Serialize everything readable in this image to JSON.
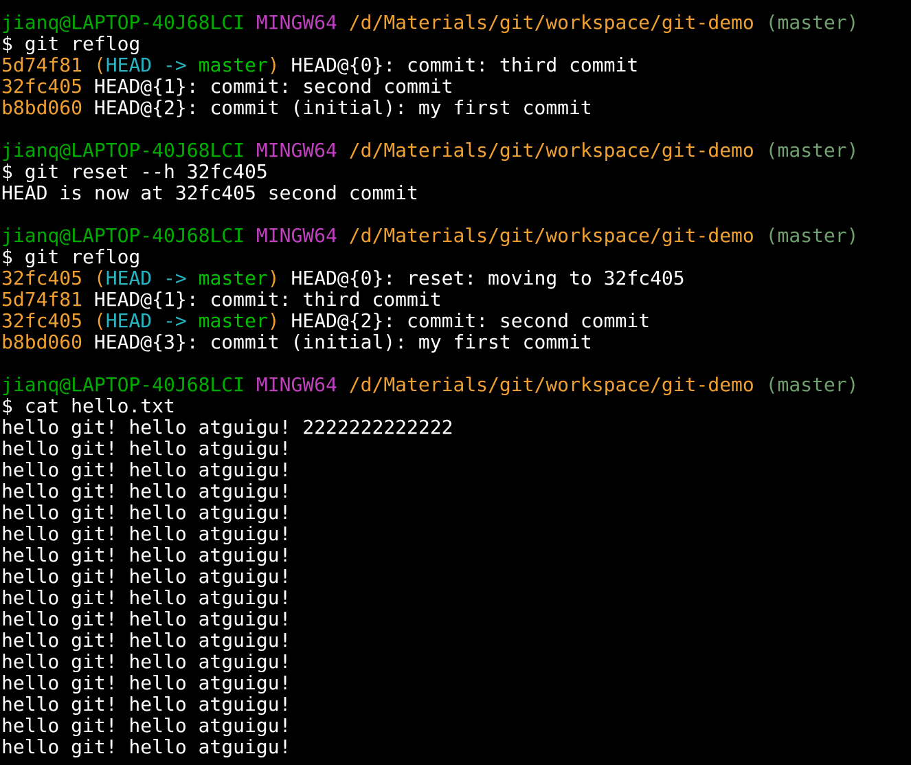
{
  "colors": {
    "background": "#000000",
    "text": "#ffffff",
    "user_host": "#00ab00",
    "mingw": "#bf3fbf",
    "path": "#f0a030",
    "branch": "#70a070",
    "hash": "#f0a030",
    "head_ref": "#27b5c2",
    "master_ref": "#00c000"
  },
  "prompt": {
    "user_host": "jianq@LAPTOP-40J68LCI",
    "system": "MINGW64",
    "path": "/d/Materials/git/workspace/git-demo",
    "branch": "(master)",
    "symbol": "$"
  },
  "blocks": [
    {
      "command": "git reflog",
      "output": [
        {
          "hash": "5d74f81",
          "decor": true,
          "text": "HEAD@{0}: commit: third commit"
        },
        {
          "hash": "32fc405",
          "decor": false,
          "text": "HEAD@{1}: commit: second commit"
        },
        {
          "hash": "b8bd060",
          "decor": false,
          "text": "HEAD@{2}: commit (initial): my first commit"
        }
      ]
    },
    {
      "command": "git reset --h 32fc405",
      "plain_output": [
        "HEAD is now at 32fc405 second commit"
      ]
    },
    {
      "command": "git reflog",
      "output": [
        {
          "hash": "32fc405",
          "decor": true,
          "text": "HEAD@{0}: reset: moving to 32fc405"
        },
        {
          "hash": "5d74f81",
          "decor": false,
          "text": "HEAD@{1}: commit: third commit"
        },
        {
          "hash": "32fc405",
          "decor": true,
          "text": "HEAD@{2}: commit: second commit"
        },
        {
          "hash": "b8bd060",
          "decor": false,
          "text": "HEAD@{3}: commit (initial): my first commit"
        }
      ]
    },
    {
      "command": "cat hello.txt",
      "plain_output": [
        "hello git! hello atguigu! 2222222222222",
        "hello git! hello atguigu!",
        "hello git! hello atguigu!",
        "hello git! hello atguigu!",
        "hello git! hello atguigu!",
        "hello git! hello atguigu!",
        "hello git! hello atguigu!",
        "hello git! hello atguigu!",
        "hello git! hello atguigu!",
        "hello git! hello atguigu!",
        "hello git! hello atguigu!",
        "hello git! hello atguigu!",
        "hello git! hello atguigu!",
        "hello git! hello atguigu!",
        "hello git! hello atguigu!",
        "hello git! hello atguigu!"
      ]
    }
  ],
  "decoration": {
    "open": "(",
    "head": "HEAD",
    "arrow": " -> ",
    "master": "master",
    "close": ")"
  }
}
